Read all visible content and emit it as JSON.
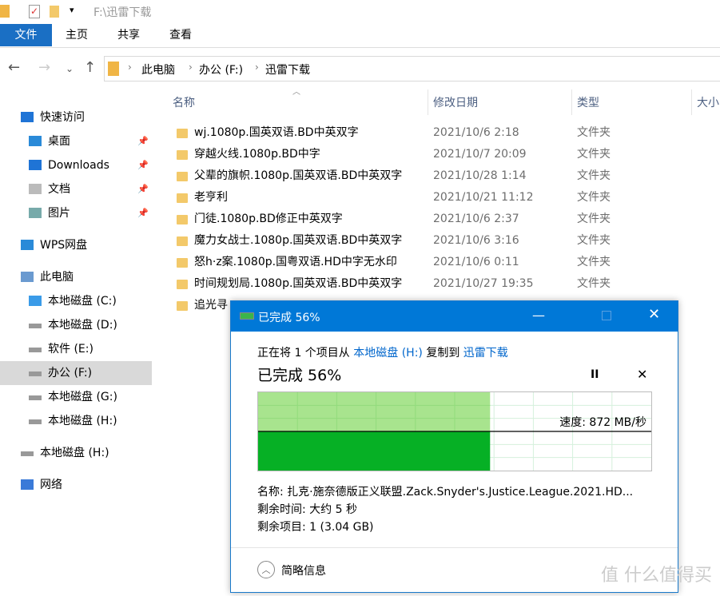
{
  "window": {
    "title": "F:\\迅雷下载"
  },
  "ribbon": {
    "tabs": [
      "文件",
      "主页",
      "共享",
      "查看"
    ]
  },
  "breadcrumb": [
    "此电脑",
    "办公 (F:)",
    "迅雷下载"
  ],
  "sidebar": {
    "items": [
      {
        "label": "快速访问",
        "icon": "star-icon",
        "pinned": false
      },
      {
        "label": "桌面",
        "icon": "desktop-icon",
        "pinned": true
      },
      {
        "label": "Downloads",
        "icon": "download-icon",
        "pinned": true
      },
      {
        "label": "文档",
        "icon": "document-icon",
        "pinned": true
      },
      {
        "label": "图片",
        "icon": "pictures-icon",
        "pinned": true
      },
      {
        "label": "WPS网盘",
        "icon": "cloud-icon",
        "pinned": false
      },
      {
        "label": "此电脑",
        "icon": "computer-icon",
        "pinned": false
      },
      {
        "label": "本地磁盘 (C:)",
        "icon": "windows-drive-icon",
        "pinned": false
      },
      {
        "label": "本地磁盘 (D:)",
        "icon": "drive-icon",
        "pinned": false
      },
      {
        "label": "软件 (E:)",
        "icon": "drive-icon",
        "pinned": false
      },
      {
        "label": "办公 (F:)",
        "icon": "drive-icon",
        "pinned": false,
        "selected": true
      },
      {
        "label": "本地磁盘 (G:)",
        "icon": "drive-icon",
        "pinned": false
      },
      {
        "label": "本地磁盘 (H:)",
        "icon": "drive-icon",
        "pinned": false
      },
      {
        "label": "本地磁盘 (H:)",
        "icon": "drive-icon",
        "pinned": false
      },
      {
        "label": "网络",
        "icon": "network-icon",
        "pinned": false
      }
    ]
  },
  "columns": [
    "名称",
    "修改日期",
    "类型",
    "大小"
  ],
  "files": [
    {
      "name": "wj.1080p.国英双语.BD中英双字",
      "date": "2021/10/6 2:18",
      "type": "文件夹"
    },
    {
      "name": "穿越火线.1080p.BD中字",
      "date": "2021/10/7 20:09",
      "type": "文件夹"
    },
    {
      "name": "父辈的旗帜.1080p.国英双语.BD中英双字",
      "date": "2021/10/28 1:14",
      "type": "文件夹"
    },
    {
      "name": "老亨利",
      "date": "2021/10/21 11:12",
      "type": "文件夹"
    },
    {
      "name": "门徒.1080p.BD修正中英双字",
      "date": "2021/10/6 2:37",
      "type": "文件夹"
    },
    {
      "name": "魔力女战士.1080p.国英双语.BD中英双字",
      "date": "2021/10/6 3:16",
      "type": "文件夹"
    },
    {
      "name": "怒h·z案.1080p.国粤双语.HD中字无水印",
      "date": "2021/10/6 0:11",
      "type": "文件夹"
    },
    {
      "name": "时间规划局.1080p.国英双语.BD中英双字",
      "date": "2021/10/27 19:35",
      "type": "文件夹"
    },
    {
      "name": "追光寻",
      "date": "",
      "type": ""
    }
  ],
  "dialog": {
    "title": "已完成 56%",
    "line_prefix": "正在将 1 个项目从 ",
    "source": "本地磁盘 (H:)",
    "line_mid": " 复制到 ",
    "dest": "迅雷下载",
    "status": "已完成 56%",
    "progress": 0.56,
    "speed": "速度: 872 MB/秒",
    "name": "名称: 扎克·施奈德版正义联盟.Zack.Snyder's.Justice.League.2021.HD...",
    "time_left": "剩余时间: 大约 5 秒",
    "items_left": "剩余项目: 1 (3.04 GB)",
    "less_details": "简略信息",
    "colors": {
      "fill_light": "#a8e48e",
      "fill_dark": "#06b025",
      "titlebar": "#0078d7"
    }
  },
  "watermark": "值 什么值得买"
}
